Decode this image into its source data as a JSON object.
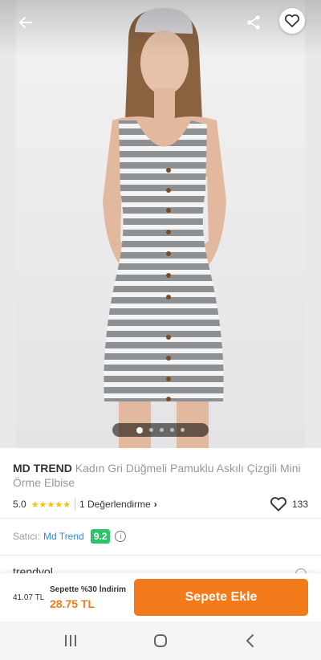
{
  "product": {
    "brand": "MD TREND",
    "name": "Kadın Gri Düğmeli Pamuklu Askılı Çizgili Mini Örme Elbise",
    "rating": "5.0",
    "stars": "★★★★★",
    "reviews_label": "1 Değerlendirme",
    "likes": "133"
  },
  "gallery": {
    "image_count": 5,
    "active_index": 0
  },
  "seller": {
    "label": "Satıcı:",
    "name": "Md Trend",
    "score": "9.2"
  },
  "next_section_peek": "trendyol",
  "checkout": {
    "old_price": "41.07 TL",
    "promo": "Sepette %30 İndirim",
    "new_price": "28.75 TL",
    "add_to_cart": "Sepete Ekle"
  },
  "colors": {
    "accent": "#f27a1a",
    "seller_link": "#2f8ad7",
    "score_badge": "#2ec26a",
    "star": "#ffc000"
  },
  "icons": {
    "back": "arrow-left-icon",
    "share": "share-icon",
    "favorite": "heart-icon",
    "info": "info-icon",
    "nav_recent": "recent-apps-icon",
    "nav_home": "home-icon",
    "nav_back": "back-chevron-icon"
  }
}
